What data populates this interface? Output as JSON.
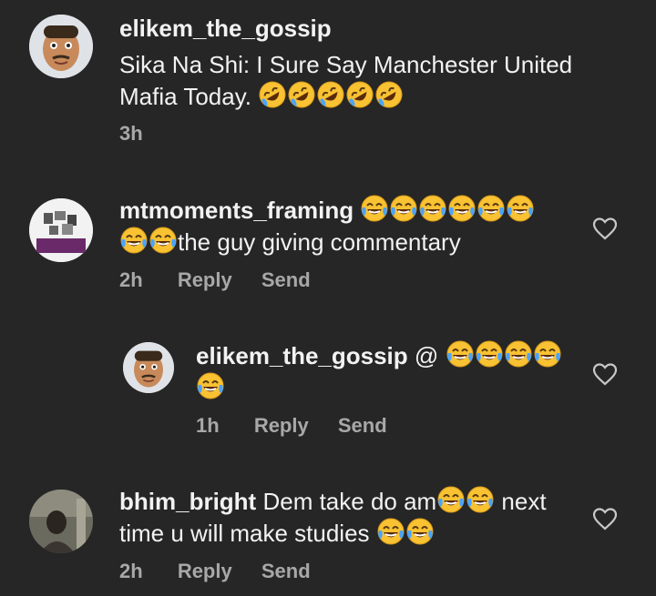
{
  "comments": [
    {
      "username": "elikem_the_gossip",
      "text": "Sika Na Shi: I Sure Say Manchester United Mafia Today. 🤣🤣🤣🤣🤣",
      "line1": "Sika Na Shi: I Sure Say Manchester United",
      "line2": "Mafia Today.",
      "emoji": "rolling-on-floor-laughing",
      "emoji_count": 5,
      "time": "3h"
    },
    {
      "username": "mtmoments_framing",
      "line2": "the guy giving commentary",
      "emoji": "tears-of-joy",
      "time": "2h",
      "reply_label": "Reply",
      "send_label": "Send"
    },
    {
      "username": "elikem_the_gossip",
      "line1": "@",
      "emoji": "tears-of-joy",
      "time": "1h",
      "reply_label": "Reply",
      "send_label": "Send"
    },
    {
      "username": "bhim_bright",
      "line1": "Dem take do am",
      "line1b": " next",
      "line2": "time u will make studies ",
      "emoji": "tears-of-joy",
      "time": "2h",
      "reply_label": "Reply",
      "send_label": "Send"
    }
  ],
  "colors": {
    "background": "#262626",
    "text": "#f5f5f5",
    "muted": "#a8a8a8",
    "emoji": "#f8c233"
  },
  "icons": [
    "heart-outline-icon",
    "tears-of-joy-emoji",
    "rolling-laughing-emoji"
  ]
}
